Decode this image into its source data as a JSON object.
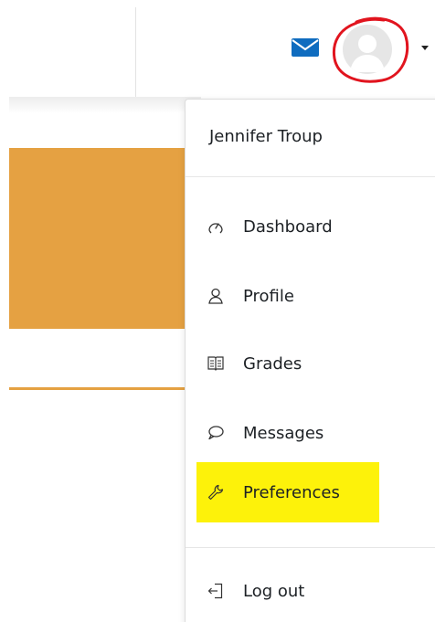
{
  "user": {
    "name": "Jennifer Troup"
  },
  "menu": {
    "items": [
      {
        "label": "Dashboard",
        "icon": "dashboard-icon"
      },
      {
        "label": "Profile",
        "icon": "profile-icon"
      },
      {
        "label": "Grades",
        "icon": "grades-icon"
      },
      {
        "label": "Messages",
        "icon": "messages-icon"
      },
      {
        "label": "Preferences",
        "icon": "wrench-icon"
      },
      {
        "label": "Log out",
        "icon": "logout-icon"
      }
    ]
  },
  "colors": {
    "accent_orange": "#e5a142",
    "mail_blue": "#0f6cbf",
    "highlight_yellow": "#fdf20a",
    "annotation_red": "#e1141e"
  }
}
